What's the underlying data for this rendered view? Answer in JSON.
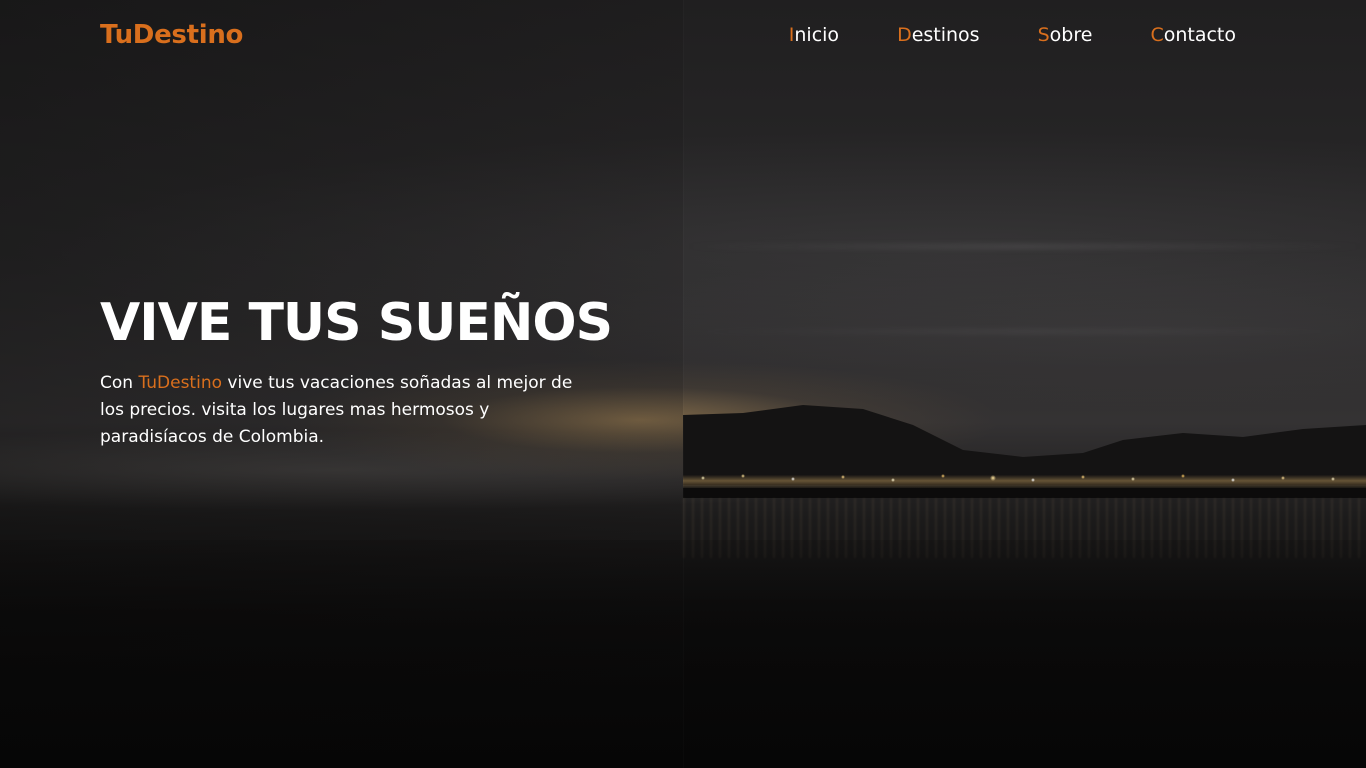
{
  "header": {
    "logo": "TuDestino",
    "nav": [
      {
        "first": "I",
        "rest": "nicio"
      },
      {
        "first": "D",
        "rest": "estinos"
      },
      {
        "first": "S",
        "rest": "obre"
      },
      {
        "first": "C",
        "rest": "ontacto"
      }
    ]
  },
  "hero": {
    "title": "VIVE TUS SUEÑOS",
    "text_before": "Con ",
    "brand": "TuDestino",
    "text_after": " vive tus vacaciones soñadas al mejor de los precios. visita los lugares mas hermosos y paradisíacos de Colombia."
  },
  "colors": {
    "accent": "#d96f1d",
    "text": "#ffffff",
    "background": "#0e0d0d"
  }
}
